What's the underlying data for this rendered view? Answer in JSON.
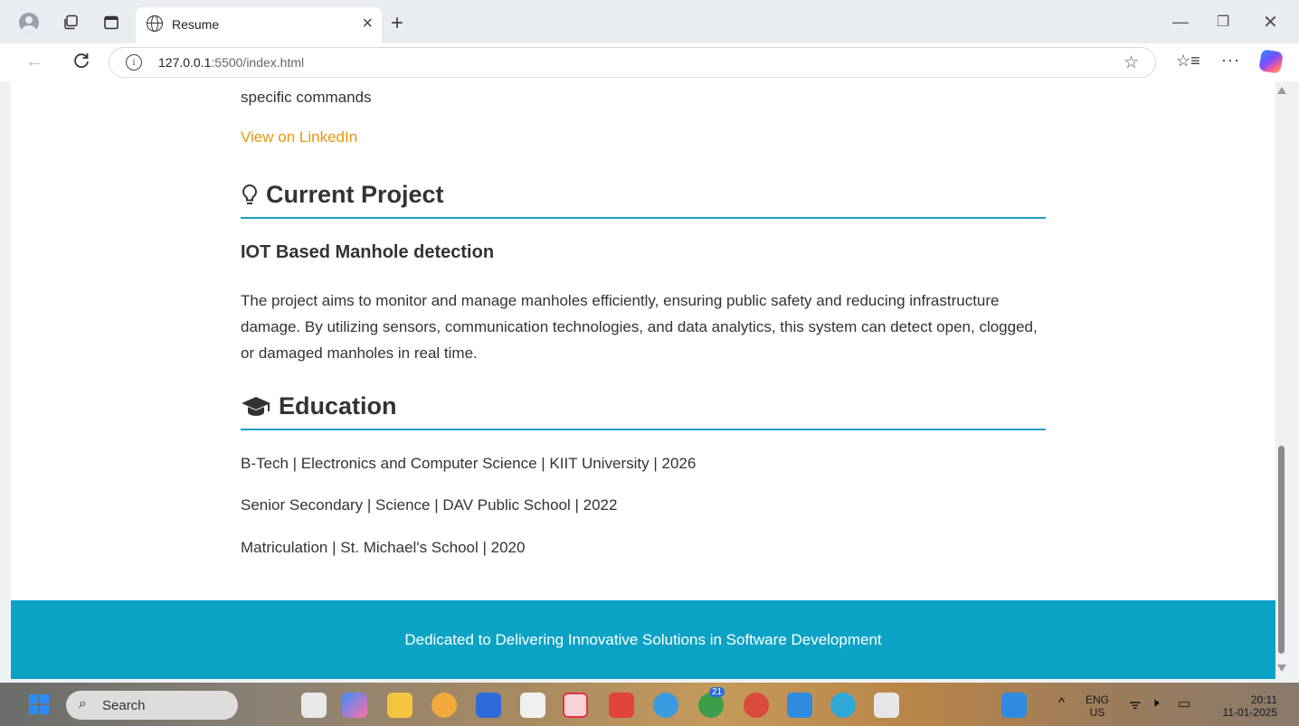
{
  "browser": {
    "tab_title": "Resume",
    "url_host": "127.0.0.1",
    "url_rest": ":5500/index.html"
  },
  "page": {
    "top_text": "specific commands",
    "linkedin_link": "View on LinkedIn",
    "current_project": {
      "heading": "Current Project",
      "title": "IOT Based Manhole detection",
      "description": "The project aims to monitor and manage manholes efficiently, ensuring public safety and reducing infrastructure damage. By utilizing sensors, communication technologies, and data analytics, this system can detect open, clogged, or damaged manholes in real time."
    },
    "education": {
      "heading": "Education",
      "items": [
        "B-Tech | Electronics and Computer Science | KIIT University | 2026",
        "Senior Secondary | Science | DAV Public School | 2022",
        "Matriculation | St. Michael's School | 2020"
      ]
    },
    "footer": "Dedicated to Delivering Innovative Solutions in Software Development"
  },
  "taskbar": {
    "search_label": "Search",
    "lang_top": "ENG",
    "lang_bottom": "US",
    "time": "20:11",
    "date": "11-01-2025",
    "badge_count": "21"
  },
  "colors": {
    "accent": "#1ea0c6",
    "link": "#e8960f",
    "footer_bg": "#0aa3c6"
  }
}
